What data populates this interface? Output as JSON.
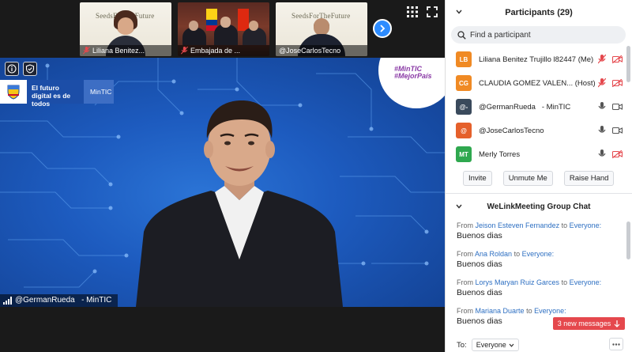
{
  "gallery": {
    "thumbnails": [
      {
        "name": "Liliana Benitez...",
        "logo": "SeedsForTheFuture",
        "muted": true
      },
      {
        "name": "Embajada de ...",
        "muted": true
      },
      {
        "name": "@JoseCarlosTecno",
        "logo": "SeedsForTheFuture",
        "muted": false
      }
    ]
  },
  "main_video": {
    "speaker_name": "@GermanRueda   - MinTIC",
    "brand_tagline": "El futuro digital es de todos",
    "brand_org": "MinTIC",
    "corner_badge": "#MinTIC\n#MejorPaís"
  },
  "participants": {
    "header": "Participants (29)",
    "search_placeholder": "Find a participant",
    "list": [
      {
        "initials": "LB",
        "color": "#f08a24",
        "name": "Liliana Benitez Trujillo l82447 (Me)",
        "mic": "muted",
        "video": "off"
      },
      {
        "initials": "CG",
        "color": "#f08a24",
        "name": "CLAUDIA GOMEZ VALEN... (Host)",
        "mic": "muted",
        "video": "off"
      },
      {
        "initials": "@-",
        "color": "#3a4a5c",
        "name": "@GermanRueda   - MinTIC",
        "mic": "on",
        "video": "on"
      },
      {
        "initials": "@",
        "color": "#e5602b",
        "name": "@JoseCarlosTecno",
        "mic": "on",
        "video": "on"
      },
      {
        "initials": "MT",
        "color": "#2fa84f",
        "name": "Merly Torres",
        "mic": "on",
        "video": "off"
      }
    ],
    "buttons": {
      "invite": "Invite",
      "unmute": "Unmute Me",
      "raise": "Raise Hand"
    }
  },
  "chat": {
    "header": "WeLinkMeeting Group Chat",
    "messages": [
      {
        "from_prefix": "From",
        "sender": "Jeison Esteven Fernandez",
        "to_word": "to",
        "recipient": "Everyone:",
        "text": "Buenos dias"
      },
      {
        "from_prefix": "From",
        "sender": "Ana Roldan",
        "to_word": "to",
        "recipient": "Everyone:",
        "text": "Buenos dias"
      },
      {
        "from_prefix": "From",
        "sender": "Lorys Maryan Ruiz Garces",
        "to_word": "to",
        "recipient": "Everyone:",
        "text": "Buenos dias"
      },
      {
        "from_prefix": "From",
        "sender": "Mariana Duarte",
        "to_word": "to",
        "recipient": "Everyone:",
        "text": "Buenos dias"
      }
    ],
    "new_messages": "3 new messages",
    "to_label": "To:",
    "to_value": "Everyone"
  },
  "colors": {
    "accent": "#2d8cff",
    "alert": "#e5484d",
    "muted_red": "#e5484d"
  }
}
